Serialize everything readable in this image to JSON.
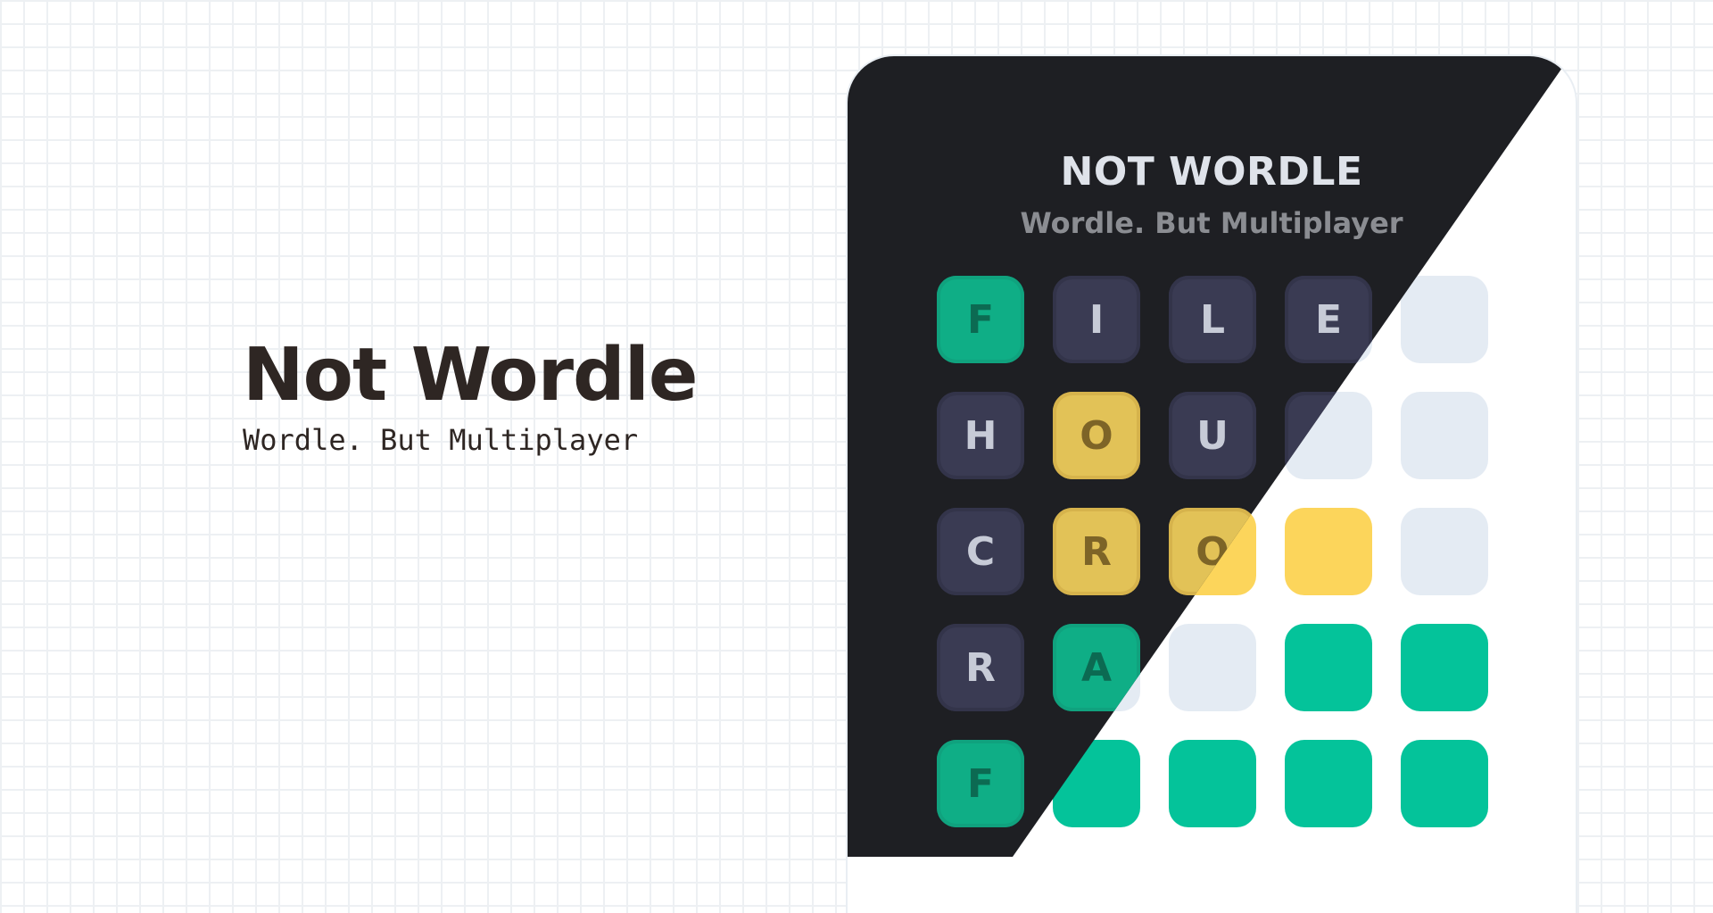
{
  "hero": {
    "title": "Not Wordle",
    "subtitle": "Wordle. But Multiplayer"
  },
  "card": {
    "title": "NOT WORDLE",
    "subtitle": "Wordle. But Multiplayer"
  },
  "board": {
    "dark_rows": [
      [
        {
          "letter": "F",
          "state": "green"
        },
        {
          "letter": "I",
          "state": "gray"
        },
        {
          "letter": "L",
          "state": "gray"
        },
        {
          "letter": "E",
          "state": "gray"
        }
      ],
      [
        {
          "letter": "H",
          "state": "gray"
        },
        {
          "letter": "O",
          "state": "yellow"
        },
        {
          "letter": "U",
          "state": "gray"
        },
        {
          "letter": "",
          "state": "gray"
        }
      ],
      [
        {
          "letter": "C",
          "state": "gray"
        },
        {
          "letter": "R",
          "state": "yellow"
        },
        {
          "letter": "O",
          "state": "yellow"
        }
      ],
      [
        {
          "letter": "R",
          "state": "gray"
        },
        {
          "letter": "A",
          "state": "green"
        }
      ],
      [
        {
          "letter": "F",
          "state": "green"
        }
      ]
    ],
    "light_rows": [
      [
        "empty",
        "empty",
        "empty",
        "empty",
        "empty"
      ],
      [
        "empty",
        "empty",
        "empty",
        "empty",
        "empty"
      ],
      [
        "empty",
        "empty",
        "yellow",
        "yellow",
        "empty"
      ],
      [
        "empty",
        "empty",
        "empty",
        "green",
        "green"
      ],
      [
        "green",
        "green",
        "green",
        "green",
        "green"
      ]
    ]
  },
  "colors": {
    "dark_bg": "#1e1f23",
    "green": "#04c39a",
    "yellow": "#fcd55b",
    "gray_tile": "#3a3b53",
    "empty_tile": "#e4ebf3",
    "ink": "#2e2623"
  }
}
